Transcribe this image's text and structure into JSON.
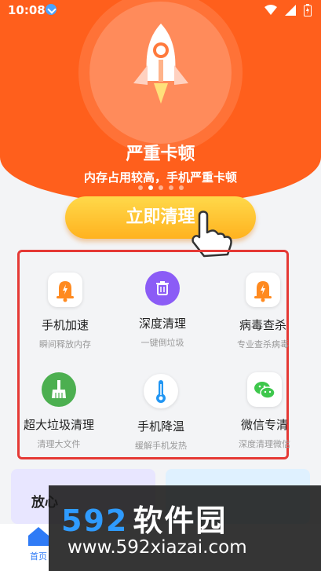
{
  "status_bar": {
    "time": "10:08"
  },
  "hero": {
    "title": "严重卡顿",
    "subtitle": "内存占用较高，手机严重卡顿",
    "active_dot": 1
  },
  "cta": {
    "label": "立即清理"
  },
  "tools": [
    {
      "name": "手机加速",
      "desc": "瞬间释放内存",
      "icon": "bell-boost-icon",
      "color": "#ff8a1f"
    },
    {
      "name": "深度清理",
      "desc": "一键倒垃圾",
      "icon": "trash-icon",
      "color": "#8b5cf6"
    },
    {
      "name": "病毒查杀",
      "desc": "专业查杀病毒",
      "icon": "virus-scan-icon",
      "color": "#ff8a1f"
    },
    {
      "name": "超大垃圾清理",
      "desc": "清理大文件",
      "icon": "broom-icon",
      "color": "#4caf50"
    },
    {
      "name": "手机降温",
      "desc": "缓解手机发热",
      "icon": "thermometer-icon",
      "color": "#2196f3"
    },
    {
      "name": "微信专清",
      "desc": "深度清理微信",
      "icon": "wechat-icon",
      "color": "#3ec74c"
    }
  ],
  "banner": {
    "left_title": "放心"
  },
  "tabbar": {
    "home_label": "首页"
  },
  "watermark": {
    "brand_num": "592",
    "brand_zh": "软件园",
    "url": "www.592xiazai.com"
  }
}
